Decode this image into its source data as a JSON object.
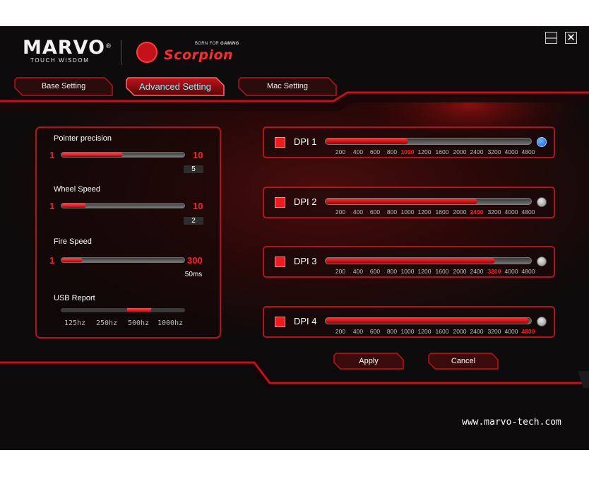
{
  "window": {
    "minimize_symbol": "—",
    "close_symbol": "✕"
  },
  "brand": {
    "logo_name": "MARVO",
    "logo_registered": "®",
    "tagline": "TOUCH WISDOM",
    "product_logo": "Scorpion",
    "product_tagline_prefix": "BORN FOR",
    "product_tagline_emphasis": "GAMING",
    "scorpion_icon": "scorpion-icon"
  },
  "tabs": [
    {
      "label": "Base Setting",
      "active": false
    },
    {
      "label": "Advanced Setting",
      "active": true
    },
    {
      "label": "Mac Setting",
      "active": false
    }
  ],
  "pointer_precision": {
    "label": "Pointer precision",
    "min": "1",
    "max": "10",
    "value": "5",
    "level": 0.5
  },
  "wheel_speed": {
    "label": "Wheel Speed",
    "min": "1",
    "max": "10",
    "value": "2",
    "level": 0.2
  },
  "fire_speed": {
    "label": "Fire Speed",
    "min": "1",
    "max": "300",
    "value": "50ms",
    "level": 0.17
  },
  "usb_report": {
    "label": "USB Report",
    "options": [
      "125hz",
      "250hz",
      "500hz",
      "1000hz"
    ],
    "selected_index": 2
  },
  "dpi_ticks": [
    "200",
    "400",
    "600",
    "800",
    "1000",
    "1200",
    "1600",
    "2000",
    "2400",
    "3200",
    "4000",
    "4800"
  ],
  "dpi_rows": [
    {
      "label": "DPI 1",
      "selected_index": 4,
      "active": true
    },
    {
      "label": "DPI 2",
      "selected_index": 8,
      "active": false
    },
    {
      "label": "DPI 3",
      "selected_index": 9,
      "active": false
    },
    {
      "label": "DPI 4",
      "selected_index": 11,
      "active": false
    }
  ],
  "buttons": {
    "apply": "Apply",
    "cancel": "Cancel"
  },
  "website": "www.marvo-tech.com",
  "colors": {
    "accent_red": "#ff2222",
    "active_tab_text": "#7ff0ff",
    "selected_radio": "#1a5cdb"
  }
}
